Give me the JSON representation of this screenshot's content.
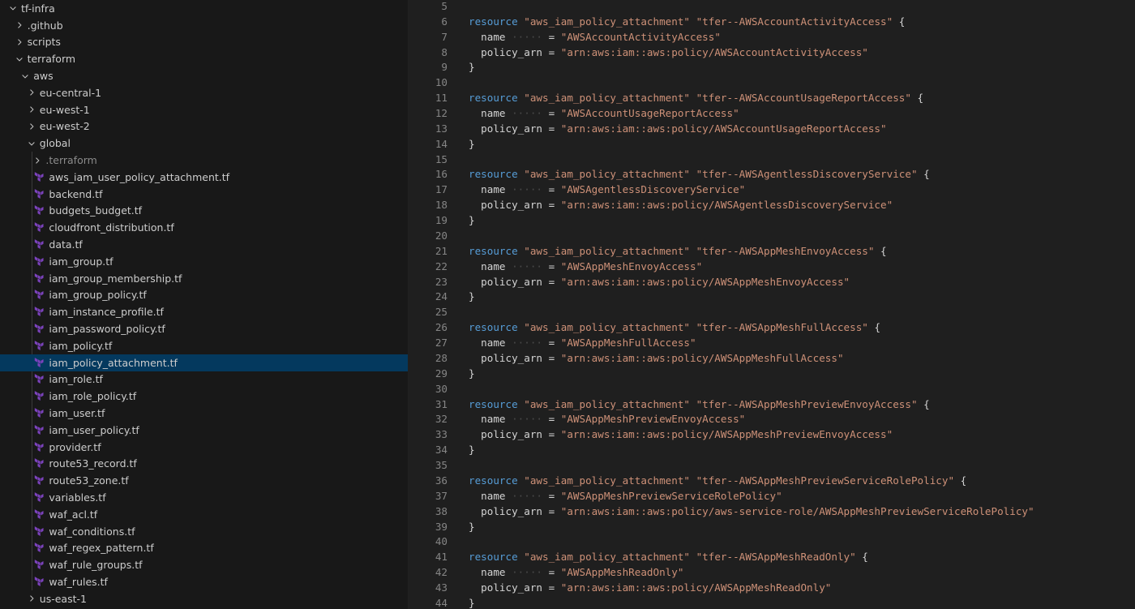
{
  "colors": {
    "sidebar_bg": "#181818",
    "editor_bg": "#1f1f1f",
    "selection_bg": "#04395e",
    "keyword": "#569cd6",
    "string": "#ce9178",
    "terraform_icon": "#7b42bc"
  },
  "explorer": {
    "items": [
      {
        "label": "tf-infra",
        "depth": 0,
        "type": "folder",
        "expanded": true
      },
      {
        "label": ".github",
        "depth": 1,
        "type": "folder",
        "expanded": false
      },
      {
        "label": "scripts",
        "depth": 1,
        "type": "folder",
        "expanded": false
      },
      {
        "label": "terraform",
        "depth": 1,
        "type": "folder",
        "expanded": true
      },
      {
        "label": "aws",
        "depth": 2,
        "type": "folder",
        "expanded": true
      },
      {
        "label": "eu-central-1",
        "depth": 3,
        "type": "folder",
        "expanded": false
      },
      {
        "label": "eu-west-1",
        "depth": 3,
        "type": "folder",
        "expanded": false
      },
      {
        "label": "eu-west-2",
        "depth": 3,
        "type": "folder",
        "expanded": false
      },
      {
        "label": "global",
        "depth": 3,
        "type": "folder",
        "expanded": true
      },
      {
        "label": ".terraform",
        "depth": 4,
        "type": "folder",
        "expanded": false,
        "dim": true
      },
      {
        "label": "aws_iam_user_policy_attachment.tf",
        "depth": 4,
        "type": "tf"
      },
      {
        "label": "backend.tf",
        "depth": 4,
        "type": "tf"
      },
      {
        "label": "budgets_budget.tf",
        "depth": 4,
        "type": "tf"
      },
      {
        "label": "cloudfront_distribution.tf",
        "depth": 4,
        "type": "tf"
      },
      {
        "label": "data.tf",
        "depth": 4,
        "type": "tf"
      },
      {
        "label": "iam_group.tf",
        "depth": 4,
        "type": "tf"
      },
      {
        "label": "iam_group_membership.tf",
        "depth": 4,
        "type": "tf"
      },
      {
        "label": "iam_group_policy.tf",
        "depth": 4,
        "type": "tf"
      },
      {
        "label": "iam_instance_profile.tf",
        "depth": 4,
        "type": "tf"
      },
      {
        "label": "iam_password_policy.tf",
        "depth": 4,
        "type": "tf"
      },
      {
        "label": "iam_policy.tf",
        "depth": 4,
        "type": "tf"
      },
      {
        "label": "iam_policy_attachment.tf",
        "depth": 4,
        "type": "tf",
        "selected": true
      },
      {
        "label": "iam_role.tf",
        "depth": 4,
        "type": "tf"
      },
      {
        "label": "iam_role_policy.tf",
        "depth": 4,
        "type": "tf"
      },
      {
        "label": "iam_user.tf",
        "depth": 4,
        "type": "tf"
      },
      {
        "label": "iam_user_policy.tf",
        "depth": 4,
        "type": "tf"
      },
      {
        "label": "provider.tf",
        "depth": 4,
        "type": "tf"
      },
      {
        "label": "route53_record.tf",
        "depth": 4,
        "type": "tf"
      },
      {
        "label": "route53_zone.tf",
        "depth": 4,
        "type": "tf"
      },
      {
        "label": "variables.tf",
        "depth": 4,
        "type": "tf"
      },
      {
        "label": "waf_acl.tf",
        "depth": 4,
        "type": "tf"
      },
      {
        "label": "waf_conditions.tf",
        "depth": 4,
        "type": "tf"
      },
      {
        "label": "waf_regex_pattern.tf",
        "depth": 4,
        "type": "tf"
      },
      {
        "label": "waf_rule_groups.tf",
        "depth": 4,
        "type": "tf"
      },
      {
        "label": "waf_rules.tf",
        "depth": 4,
        "type": "tf"
      },
      {
        "label": "us-east-1",
        "depth": 3,
        "type": "folder",
        "expanded": false
      }
    ]
  },
  "editor": {
    "lines": [
      {
        "n": "5",
        "tokens": []
      },
      {
        "n": "6",
        "tokens": [
          [
            "kw",
            "resource"
          ],
          [
            "p",
            " "
          ],
          [
            "s",
            "\"aws_iam_policy_attachment\""
          ],
          [
            "p",
            " "
          ],
          [
            "s",
            "\"tfer--AWSAccountActivityAccess\""
          ],
          [
            "p",
            " {"
          ]
        ]
      },
      {
        "n": "7",
        "tokens": [
          [
            "p",
            "  "
          ],
          [
            "a",
            "name"
          ],
          [
            "d",
            " ····· "
          ],
          [
            "p",
            "= "
          ],
          [
            "s",
            "\"AWSAccountActivityAccess\""
          ]
        ]
      },
      {
        "n": "8",
        "tokens": [
          [
            "p",
            "  "
          ],
          [
            "a",
            "policy_arn"
          ],
          [
            "p",
            " = "
          ],
          [
            "s",
            "\"arn:aws:iam::aws:policy/AWSAccountActivityAccess\""
          ]
        ]
      },
      {
        "n": "9",
        "tokens": [
          [
            "p",
            "}"
          ]
        ]
      },
      {
        "n": "10",
        "tokens": []
      },
      {
        "n": "11",
        "tokens": [
          [
            "kw",
            "resource"
          ],
          [
            "p",
            " "
          ],
          [
            "s",
            "\"aws_iam_policy_attachment\""
          ],
          [
            "p",
            " "
          ],
          [
            "s",
            "\"tfer--AWSAccountUsageReportAccess\""
          ],
          [
            "p",
            " {"
          ]
        ]
      },
      {
        "n": "12",
        "tokens": [
          [
            "p",
            "  "
          ],
          [
            "a",
            "name"
          ],
          [
            "d",
            " ····· "
          ],
          [
            "p",
            "= "
          ],
          [
            "s",
            "\"AWSAccountUsageReportAccess\""
          ]
        ]
      },
      {
        "n": "13",
        "tokens": [
          [
            "p",
            "  "
          ],
          [
            "a",
            "policy_arn"
          ],
          [
            "p",
            " = "
          ],
          [
            "s",
            "\"arn:aws:iam::aws:policy/AWSAccountUsageReportAccess\""
          ]
        ]
      },
      {
        "n": "14",
        "tokens": [
          [
            "p",
            "}"
          ]
        ]
      },
      {
        "n": "15",
        "tokens": []
      },
      {
        "n": "16",
        "tokens": [
          [
            "kw",
            "resource"
          ],
          [
            "p",
            " "
          ],
          [
            "s",
            "\"aws_iam_policy_attachment\""
          ],
          [
            "p",
            " "
          ],
          [
            "s",
            "\"tfer--AWSAgentlessDiscoveryService\""
          ],
          [
            "p",
            " {"
          ]
        ]
      },
      {
        "n": "17",
        "tokens": [
          [
            "p",
            "  "
          ],
          [
            "a",
            "name"
          ],
          [
            "d",
            " ····· "
          ],
          [
            "p",
            "= "
          ],
          [
            "s",
            "\"AWSAgentlessDiscoveryService\""
          ]
        ]
      },
      {
        "n": "18",
        "tokens": [
          [
            "p",
            "  "
          ],
          [
            "a",
            "policy_arn"
          ],
          [
            "p",
            " = "
          ],
          [
            "s",
            "\"arn:aws:iam::aws:policy/AWSAgentlessDiscoveryService\""
          ]
        ]
      },
      {
        "n": "19",
        "tokens": [
          [
            "p",
            "}"
          ]
        ]
      },
      {
        "n": "20",
        "tokens": []
      },
      {
        "n": "21",
        "tokens": [
          [
            "kw",
            "resource"
          ],
          [
            "p",
            " "
          ],
          [
            "s",
            "\"aws_iam_policy_attachment\""
          ],
          [
            "p",
            " "
          ],
          [
            "s",
            "\"tfer--AWSAppMeshEnvoyAccess\""
          ],
          [
            "p",
            " {"
          ]
        ]
      },
      {
        "n": "22",
        "tokens": [
          [
            "p",
            "  "
          ],
          [
            "a",
            "name"
          ],
          [
            "d",
            " ····· "
          ],
          [
            "p",
            "= "
          ],
          [
            "s",
            "\"AWSAppMeshEnvoyAccess\""
          ]
        ]
      },
      {
        "n": "23",
        "tokens": [
          [
            "p",
            "  "
          ],
          [
            "a",
            "policy_arn"
          ],
          [
            "p",
            " = "
          ],
          [
            "s",
            "\"arn:aws:iam::aws:policy/AWSAppMeshEnvoyAccess\""
          ]
        ]
      },
      {
        "n": "24",
        "tokens": [
          [
            "p",
            "}"
          ]
        ]
      },
      {
        "n": "25",
        "tokens": []
      },
      {
        "n": "26",
        "tokens": [
          [
            "kw",
            "resource"
          ],
          [
            "p",
            " "
          ],
          [
            "s",
            "\"aws_iam_policy_attachment\""
          ],
          [
            "p",
            " "
          ],
          [
            "s",
            "\"tfer--AWSAppMeshFullAccess\""
          ],
          [
            "p",
            " {"
          ]
        ]
      },
      {
        "n": "27",
        "tokens": [
          [
            "p",
            "  "
          ],
          [
            "a",
            "name"
          ],
          [
            "d",
            " ····· "
          ],
          [
            "p",
            "= "
          ],
          [
            "s",
            "\"AWSAppMeshFullAccess\""
          ]
        ]
      },
      {
        "n": "28",
        "tokens": [
          [
            "p",
            "  "
          ],
          [
            "a",
            "policy_arn"
          ],
          [
            "p",
            " = "
          ],
          [
            "s",
            "\"arn:aws:iam::aws:policy/AWSAppMeshFullAccess\""
          ]
        ]
      },
      {
        "n": "29",
        "tokens": [
          [
            "p",
            "}"
          ]
        ]
      },
      {
        "n": "30",
        "tokens": []
      },
      {
        "n": "31",
        "tokens": [
          [
            "kw",
            "resource"
          ],
          [
            "p",
            " "
          ],
          [
            "s",
            "\"aws_iam_policy_attachment\""
          ],
          [
            "p",
            " "
          ],
          [
            "s",
            "\"tfer--AWSAppMeshPreviewEnvoyAccess\""
          ],
          [
            "p",
            " {"
          ]
        ]
      },
      {
        "n": "32",
        "tokens": [
          [
            "p",
            "  "
          ],
          [
            "a",
            "name"
          ],
          [
            "d",
            " ····· "
          ],
          [
            "p",
            "= "
          ],
          [
            "s",
            "\"AWSAppMeshPreviewEnvoyAccess\""
          ]
        ]
      },
      {
        "n": "33",
        "tokens": [
          [
            "p",
            "  "
          ],
          [
            "a",
            "policy_arn"
          ],
          [
            "p",
            " = "
          ],
          [
            "s",
            "\"arn:aws:iam::aws:policy/AWSAppMeshPreviewEnvoyAccess\""
          ]
        ]
      },
      {
        "n": "34",
        "tokens": [
          [
            "p",
            "}"
          ]
        ]
      },
      {
        "n": "35",
        "tokens": []
      },
      {
        "n": "36",
        "tokens": [
          [
            "kw",
            "resource"
          ],
          [
            "p",
            " "
          ],
          [
            "s",
            "\"aws_iam_policy_attachment\""
          ],
          [
            "p",
            " "
          ],
          [
            "s",
            "\"tfer--AWSAppMeshPreviewServiceRolePolicy\""
          ],
          [
            "p",
            " {"
          ]
        ]
      },
      {
        "n": "37",
        "tokens": [
          [
            "p",
            "  "
          ],
          [
            "a",
            "name"
          ],
          [
            "d",
            " ····· "
          ],
          [
            "p",
            "= "
          ],
          [
            "s",
            "\"AWSAppMeshPreviewServiceRolePolicy\""
          ]
        ]
      },
      {
        "n": "38",
        "tokens": [
          [
            "p",
            "  "
          ],
          [
            "a",
            "policy_arn"
          ],
          [
            "p",
            " = "
          ],
          [
            "s",
            "\"arn:aws:iam::aws:policy/aws-service-role/AWSAppMeshPreviewServiceRolePolicy\""
          ]
        ]
      },
      {
        "n": "39",
        "tokens": [
          [
            "p",
            "}"
          ]
        ]
      },
      {
        "n": "40",
        "tokens": []
      },
      {
        "n": "41",
        "tokens": [
          [
            "kw",
            "resource"
          ],
          [
            "p",
            " "
          ],
          [
            "s",
            "\"aws_iam_policy_attachment\""
          ],
          [
            "p",
            " "
          ],
          [
            "s",
            "\"tfer--AWSAppMeshReadOnly\""
          ],
          [
            "p",
            " {"
          ]
        ]
      },
      {
        "n": "42",
        "tokens": [
          [
            "p",
            "  "
          ],
          [
            "a",
            "name"
          ],
          [
            "d",
            " ····· "
          ],
          [
            "p",
            "= "
          ],
          [
            "s",
            "\"AWSAppMeshReadOnly\""
          ]
        ]
      },
      {
        "n": "43",
        "tokens": [
          [
            "p",
            "  "
          ],
          [
            "a",
            "policy_arn"
          ],
          [
            "p",
            " = "
          ],
          [
            "s",
            "\"arn:aws:iam::aws:policy/AWSAppMeshReadOnly\""
          ]
        ]
      },
      {
        "n": "44",
        "tokens": [
          [
            "p",
            "}"
          ]
        ]
      }
    ]
  }
}
